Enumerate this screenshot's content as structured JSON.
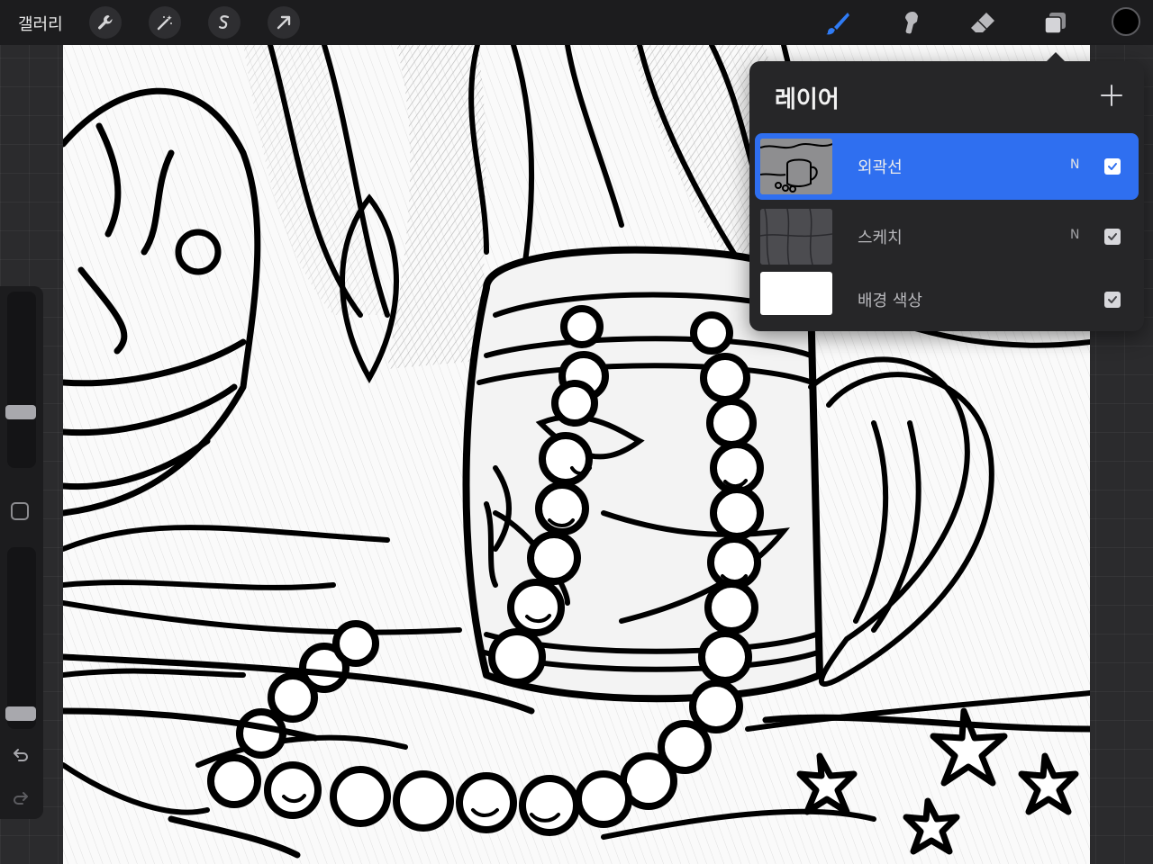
{
  "toolbar": {
    "gallery_label": "갤러리",
    "left_tools": [
      "wrench-icon",
      "magic-wand-icon",
      "selection-icon",
      "transform-arrow-icon"
    ],
    "right_tools": [
      "brush-icon",
      "smudge-icon",
      "eraser-icon",
      "layers-icon"
    ],
    "active_tool": "brush-icon",
    "active_color": "#000000",
    "accent_color": "#2f6ff0"
  },
  "sidebar": {
    "brush_size_level": 0.3,
    "opacity_level": 0.05,
    "icons": [
      "modifier-square-icon",
      "undo-icon",
      "redo-icon"
    ]
  },
  "layers_panel": {
    "title": "레이어",
    "add_button_icon": "plus-icon",
    "layers": [
      {
        "name": "외곽선",
        "blend_mode": "N",
        "visible": true,
        "selected": true
      },
      {
        "name": "스케치",
        "blend_mode": "N",
        "visible": true,
        "selected": false
      },
      {
        "name": "배경 색상",
        "blend_mode": "",
        "visible": true,
        "selected": false
      }
    ]
  }
}
